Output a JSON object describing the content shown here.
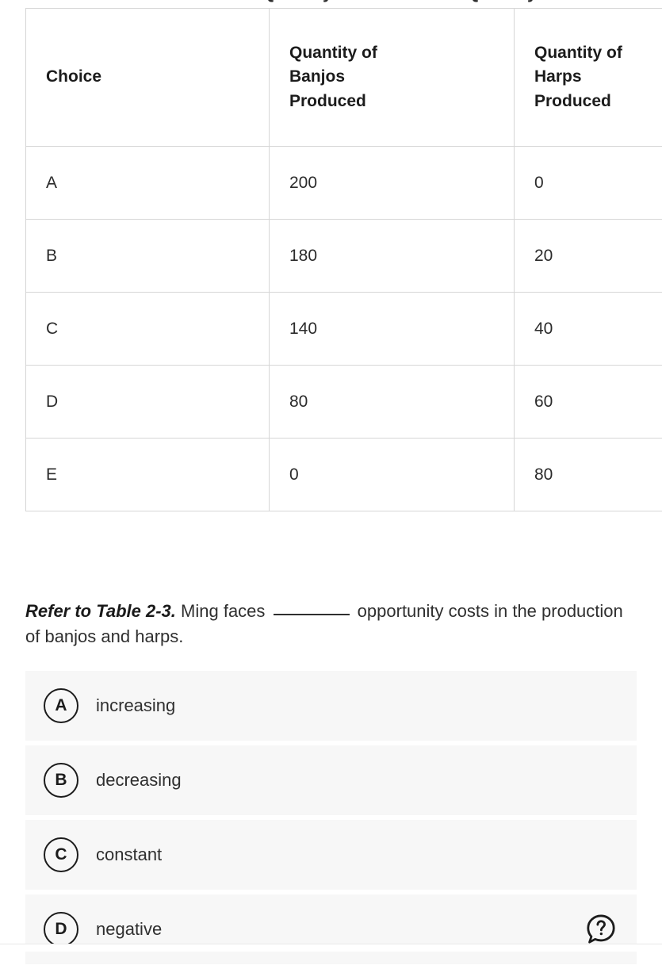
{
  "table": {
    "headers": [
      "Choice",
      "Quantity of Banjos Produced",
      "Quantity of Harps Produced"
    ],
    "header_lines": [
      [
        "Choice"
      ],
      [
        "Quantity of",
        "Banjos",
        "Produced"
      ],
      [
        "Quantity of",
        "Harps",
        "Produced"
      ]
    ],
    "rows": [
      {
        "choice": "A",
        "banjos": "200",
        "harps": "0"
      },
      {
        "choice": "B",
        "banjos": "180",
        "harps": "20"
      },
      {
        "choice": "C",
        "banjos": "140",
        "harps": "40"
      },
      {
        "choice": "D",
        "banjos": "80",
        "harps": "60"
      },
      {
        "choice": "E",
        "banjos": "0",
        "harps": "80"
      }
    ]
  },
  "question": {
    "reference": "Refer to Table 2-3.",
    "text_before_blank": "Ming faces",
    "text_after_blank": "opportunity costs in the production of banjos and harps."
  },
  "options": [
    {
      "letter": "A",
      "label": "increasing"
    },
    {
      "letter": "B",
      "label": "decreasing"
    },
    {
      "letter": "C",
      "label": "constant"
    },
    {
      "letter": "D",
      "label": "negative"
    }
  ],
  "help": {
    "icon": "question-mark-speech-bubble-icon"
  },
  "colors": {
    "page_background": "#ffffff",
    "table_border": "#d6d6d6",
    "option_background": "#f7f7f7",
    "text": "#2b2b2b"
  },
  "top_clipped_fragment": "Quantity of"
}
